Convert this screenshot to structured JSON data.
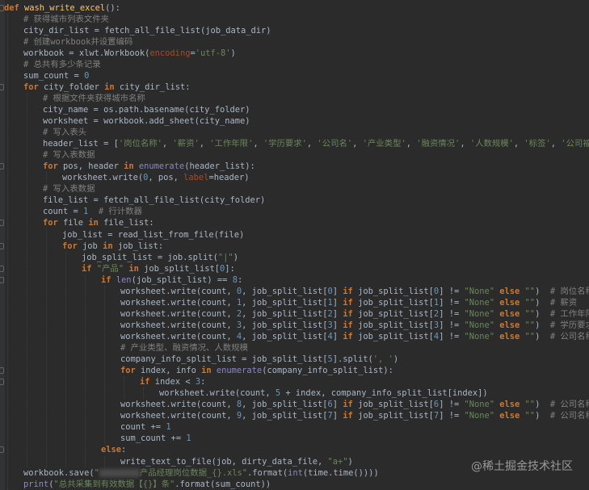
{
  "editor": {
    "lines": [
      {
        "indent": 0,
        "tokens": [
          {
            "t": "def ",
            "c": "k"
          },
          {
            "t": "wash_write_excel",
            "c": "f"
          },
          {
            "t": "():"
          }
        ]
      },
      {
        "indent": 1,
        "tokens": [
          {
            "t": "# 获得城市列表文件夹",
            "c": "c"
          }
        ]
      },
      {
        "indent": 1,
        "tokens": [
          {
            "t": "city_dir_list = fetch_all_file_list(job_data_dir)"
          }
        ]
      },
      {
        "indent": 1,
        "tokens": [
          {
            "t": "# 创建workbook并设置编码",
            "c": "c"
          }
        ]
      },
      {
        "indent": 1,
        "tokens": [
          {
            "t": "workbook = xlwt.Workbook("
          },
          {
            "t": "encoding",
            "c": "p"
          },
          {
            "t": "="
          },
          {
            "t": "'utf-8'",
            "c": "s"
          },
          {
            "t": ")"
          }
        ]
      },
      {
        "indent": 1,
        "tokens": [
          {
            "t": "# 总共有多少条记录",
            "c": "c"
          }
        ]
      },
      {
        "indent": 1,
        "tokens": [
          {
            "t": "sum_count = "
          },
          {
            "t": "0",
            "c": "n"
          }
        ]
      },
      {
        "indent": 1,
        "tokens": [
          {
            "t": "for ",
            "c": "k"
          },
          {
            "t": "city_folder "
          },
          {
            "t": "in ",
            "c": "k"
          },
          {
            "t": "city_dir_list:"
          }
        ]
      },
      {
        "indent": 2,
        "tokens": [
          {
            "t": "# 根据文件夹获得城市名称",
            "c": "c"
          }
        ]
      },
      {
        "indent": 2,
        "tokens": [
          {
            "t": "city_name = os.path.basename(city_folder)"
          }
        ]
      },
      {
        "indent": 2,
        "tokens": [
          {
            "t": "worksheet = workbook.add_sheet(city_name)"
          }
        ]
      },
      {
        "indent": 2,
        "tokens": [
          {
            "t": "# 写入表头",
            "c": "c"
          }
        ]
      },
      {
        "indent": 2,
        "tokens": [
          {
            "t": "header_list = ["
          },
          {
            "t": "'岗位名称'",
            "c": "s"
          },
          {
            "t": ", "
          },
          {
            "t": "'薪资'",
            "c": "s"
          },
          {
            "t": ", "
          },
          {
            "t": "'工作年限'",
            "c": "s"
          },
          {
            "t": ", "
          },
          {
            "t": "'学历要求'",
            "c": "s"
          },
          {
            "t": ", "
          },
          {
            "t": "'公司名'",
            "c": "s"
          },
          {
            "t": ", "
          },
          {
            "t": "'产业类型'",
            "c": "s"
          },
          {
            "t": ", "
          },
          {
            "t": "'融资情况'",
            "c": "s"
          },
          {
            "t": ", "
          },
          {
            "t": "'人数规模'",
            "c": "s"
          },
          {
            "t": ", "
          },
          {
            "t": "'标签'",
            "c": "s"
          },
          {
            "t": ", "
          },
          {
            "t": "'公司福利'",
            "c": "s"
          },
          {
            "t": "]"
          }
        ]
      },
      {
        "indent": 2,
        "tokens": [
          {
            "t": "# 写入表数据",
            "c": "c"
          }
        ]
      },
      {
        "indent": 2,
        "tokens": [
          {
            "t": "for ",
            "c": "k"
          },
          {
            "t": "pos, header "
          },
          {
            "t": "in ",
            "c": "k"
          },
          {
            "t": "enumerate",
            "c": "b"
          },
          {
            "t": "(header_list):"
          }
        ]
      },
      {
        "indent": 3,
        "tokens": [
          {
            "t": "worksheet.write("
          },
          {
            "t": "0",
            "c": "n"
          },
          {
            "t": ", pos, "
          },
          {
            "t": "label",
            "c": "p"
          },
          {
            "t": "=header)"
          }
        ]
      },
      {
        "indent": 2,
        "tokens": [
          {
            "t": "# 写入表数据",
            "c": "c"
          }
        ]
      },
      {
        "indent": 2,
        "tokens": [
          {
            "t": "file_list = fetch_all_file_list(city_folder)"
          }
        ]
      },
      {
        "indent": 2,
        "tokens": [
          {
            "t": "count = "
          },
          {
            "t": "1",
            "c": "n"
          },
          {
            "t": "  "
          },
          {
            "t": "# 行计数器",
            "c": "c"
          }
        ]
      },
      {
        "indent": 2,
        "tokens": [
          {
            "t": "for ",
            "c": "k"
          },
          {
            "t": "file "
          },
          {
            "t": "in ",
            "c": "k"
          },
          {
            "t": "file_list:"
          }
        ]
      },
      {
        "indent": 3,
        "tokens": [
          {
            "t": "job_list = read_list_from_file(file)"
          }
        ]
      },
      {
        "indent": 3,
        "tokens": [
          {
            "t": "for ",
            "c": "k"
          },
          {
            "t": "job "
          },
          {
            "t": "in ",
            "c": "k"
          },
          {
            "t": "job_list:"
          }
        ]
      },
      {
        "indent": 4,
        "tokens": [
          {
            "t": "job_split_list = job.split("
          },
          {
            "t": "\"|\"",
            "c": "s"
          },
          {
            "t": ")"
          }
        ]
      },
      {
        "indent": 4,
        "tokens": [
          {
            "t": "if ",
            "c": "k"
          },
          {
            "t": "\"产品\" ",
            "c": "s"
          },
          {
            "t": "in ",
            "c": "k"
          },
          {
            "t": "job_split_list["
          },
          {
            "t": "0",
            "c": "n"
          },
          {
            "t": "]:"
          }
        ]
      },
      {
        "indent": 5,
        "tokens": [
          {
            "t": "if ",
            "c": "k"
          },
          {
            "t": "len",
            "c": "b"
          },
          {
            "t": "(job_split_list) == "
          },
          {
            "t": "8",
            "c": "n"
          },
          {
            "t": ":"
          }
        ]
      },
      {
        "indent": 6,
        "tokens": [
          {
            "t": "worksheet.write(count, "
          },
          {
            "t": "0",
            "c": "n"
          },
          {
            "t": ", job_split_list["
          },
          {
            "t": "0",
            "c": "n"
          },
          {
            "t": "] "
          },
          {
            "t": "if ",
            "c": "k"
          },
          {
            "t": "job_split_list["
          },
          {
            "t": "0",
            "c": "n"
          },
          {
            "t": "] != "
          },
          {
            "t": "\"None\" ",
            "c": "s"
          },
          {
            "t": "else ",
            "c": "k"
          },
          {
            "t": "\"\"",
            "c": "s"
          },
          {
            "t": ")  "
          },
          {
            "t": "# 岗位名称",
            "c": "c"
          }
        ]
      },
      {
        "indent": 6,
        "tokens": [
          {
            "t": "worksheet.write(count, "
          },
          {
            "t": "1",
            "c": "n"
          },
          {
            "t": ", job_split_list["
          },
          {
            "t": "1",
            "c": "n"
          },
          {
            "t": "] "
          },
          {
            "t": "if ",
            "c": "k"
          },
          {
            "t": "job_split_list["
          },
          {
            "t": "1",
            "c": "n"
          },
          {
            "t": "] != "
          },
          {
            "t": "\"None\" ",
            "c": "s"
          },
          {
            "t": "else ",
            "c": "k"
          },
          {
            "t": "\"\"",
            "c": "s"
          },
          {
            "t": ")  "
          },
          {
            "t": "# 薪资",
            "c": "c"
          }
        ]
      },
      {
        "indent": 6,
        "tokens": [
          {
            "t": "worksheet.write(count, "
          },
          {
            "t": "2",
            "c": "n"
          },
          {
            "t": ", job_split_list["
          },
          {
            "t": "2",
            "c": "n"
          },
          {
            "t": "] "
          },
          {
            "t": "if ",
            "c": "k"
          },
          {
            "t": "job_split_list["
          },
          {
            "t": "2",
            "c": "n"
          },
          {
            "t": "] != "
          },
          {
            "t": "\"None\" ",
            "c": "s"
          },
          {
            "t": "else ",
            "c": "k"
          },
          {
            "t": "\"\"",
            "c": "s"
          },
          {
            "t": ")  "
          },
          {
            "t": "# 工作年限",
            "c": "c"
          }
        ]
      },
      {
        "indent": 6,
        "tokens": [
          {
            "t": "worksheet.write(count, "
          },
          {
            "t": "3",
            "c": "n"
          },
          {
            "t": ", job_split_list["
          },
          {
            "t": "3",
            "c": "n"
          },
          {
            "t": "] "
          },
          {
            "t": "if ",
            "c": "k"
          },
          {
            "t": "job_split_list["
          },
          {
            "t": "3",
            "c": "n"
          },
          {
            "t": "] != "
          },
          {
            "t": "\"None\" ",
            "c": "s"
          },
          {
            "t": "else ",
            "c": "k"
          },
          {
            "t": "\"\"",
            "c": "s"
          },
          {
            "t": ")  "
          },
          {
            "t": "# 学历要求",
            "c": "c"
          }
        ]
      },
      {
        "indent": 6,
        "tokens": [
          {
            "t": "worksheet.write(count, "
          },
          {
            "t": "4",
            "c": "n"
          },
          {
            "t": ", job_split_list["
          },
          {
            "t": "4",
            "c": "n"
          },
          {
            "t": "] "
          },
          {
            "t": "if ",
            "c": "k"
          },
          {
            "t": "job_split_list["
          },
          {
            "t": "4",
            "c": "n"
          },
          {
            "t": "] != "
          },
          {
            "t": "\"None\" ",
            "c": "s"
          },
          {
            "t": "else ",
            "c": "k"
          },
          {
            "t": "\"\"",
            "c": "s"
          },
          {
            "t": ")  "
          },
          {
            "t": "# 公司名称",
            "c": "c"
          }
        ]
      },
      {
        "indent": 6,
        "tokens": [
          {
            "t": "# 产业类型、融资情况、人数规模",
            "c": "c"
          }
        ]
      },
      {
        "indent": 6,
        "tokens": [
          {
            "t": "company_info_split_list = job_split_list["
          },
          {
            "t": "5",
            "c": "n"
          },
          {
            "t": "].split("
          },
          {
            "t": "', '",
            "c": "s"
          },
          {
            "t": ")"
          }
        ]
      },
      {
        "indent": 6,
        "tokens": [
          {
            "t": "for ",
            "c": "k"
          },
          {
            "t": "index, info "
          },
          {
            "t": "in ",
            "c": "k"
          },
          {
            "t": "enumerate",
            "c": "b"
          },
          {
            "t": "(company_info_split_list):"
          }
        ]
      },
      {
        "indent": 7,
        "tokens": [
          {
            "t": "if ",
            "c": "k"
          },
          {
            "t": "index < "
          },
          {
            "t": "3",
            "c": "n"
          },
          {
            "t": ":"
          }
        ]
      },
      {
        "indent": 8,
        "tokens": [
          {
            "t": "worksheet.write(count, "
          },
          {
            "t": "5",
            "c": "n"
          },
          {
            "t": " + index, company_info_split_list[index])"
          }
        ]
      },
      {
        "indent": 6,
        "tokens": [
          {
            "t": "worksheet.write(count, "
          },
          {
            "t": "8",
            "c": "n"
          },
          {
            "t": ", job_split_list["
          },
          {
            "t": "6",
            "c": "n"
          },
          {
            "t": "] "
          },
          {
            "t": "if ",
            "c": "k"
          },
          {
            "t": "job_split_list["
          },
          {
            "t": "6",
            "c": "n"
          },
          {
            "t": "] != "
          },
          {
            "t": "\"None\" ",
            "c": "s"
          },
          {
            "t": "else ",
            "c": "k"
          },
          {
            "t": "\"\"",
            "c": "s"
          },
          {
            "t": ")  "
          },
          {
            "t": "# 公司名称",
            "c": "c"
          }
        ]
      },
      {
        "indent": 6,
        "tokens": [
          {
            "t": "worksheet.write(count, "
          },
          {
            "t": "9",
            "c": "n"
          },
          {
            "t": ", job_split_list["
          },
          {
            "t": "7",
            "c": "n"
          },
          {
            "t": "] "
          },
          {
            "t": "if ",
            "c": "k"
          },
          {
            "t": "job_split_list["
          },
          {
            "t": "7",
            "c": "n"
          },
          {
            "t": "] != "
          },
          {
            "t": "\"None\" ",
            "c": "s"
          },
          {
            "t": "else ",
            "c": "k"
          },
          {
            "t": "\"\"",
            "c": "s"
          },
          {
            "t": ")  "
          },
          {
            "t": "# 公司名称",
            "c": "c"
          }
        ]
      },
      {
        "indent": 6,
        "tokens": [
          {
            "t": "count += "
          },
          {
            "t": "1",
            "c": "n"
          }
        ]
      },
      {
        "indent": 6,
        "tokens": [
          {
            "t": "sum_count += "
          },
          {
            "t": "1",
            "c": "n"
          }
        ]
      },
      {
        "indent": 5,
        "tokens": [
          {
            "t": "else",
            "c": "k"
          },
          {
            "t": ":"
          }
        ]
      },
      {
        "indent": 6,
        "tokens": [
          {
            "t": "write_text_to_file(job, dirty_data_file, "
          },
          {
            "t": "\"a+\"",
            "c": "s"
          },
          {
            "t": ")"
          }
        ]
      },
      {
        "indent": 1,
        "tokens": [
          {
            "t": "workbook.save("
          },
          {
            "t": "\"",
            "c": "s"
          },
          {
            "t": "",
            "c": "blur"
          },
          {
            "t": "产品经理岗位数据_{}.xls\"",
            "c": "s"
          },
          {
            "t": ".format("
          },
          {
            "t": "int",
            "c": "b"
          },
          {
            "t": "(time.time())))"
          }
        ]
      },
      {
        "indent": 1,
        "tokens": [
          {
            "t": "print",
            "c": "b"
          },
          {
            "t": "("
          },
          {
            "t": "\"总共采集到有效数据【{}】条\"",
            "c": "s"
          },
          {
            "t": ".format(sum_count))"
          }
        ]
      }
    ]
  },
  "watermark": "@稀土掘金技术社区"
}
